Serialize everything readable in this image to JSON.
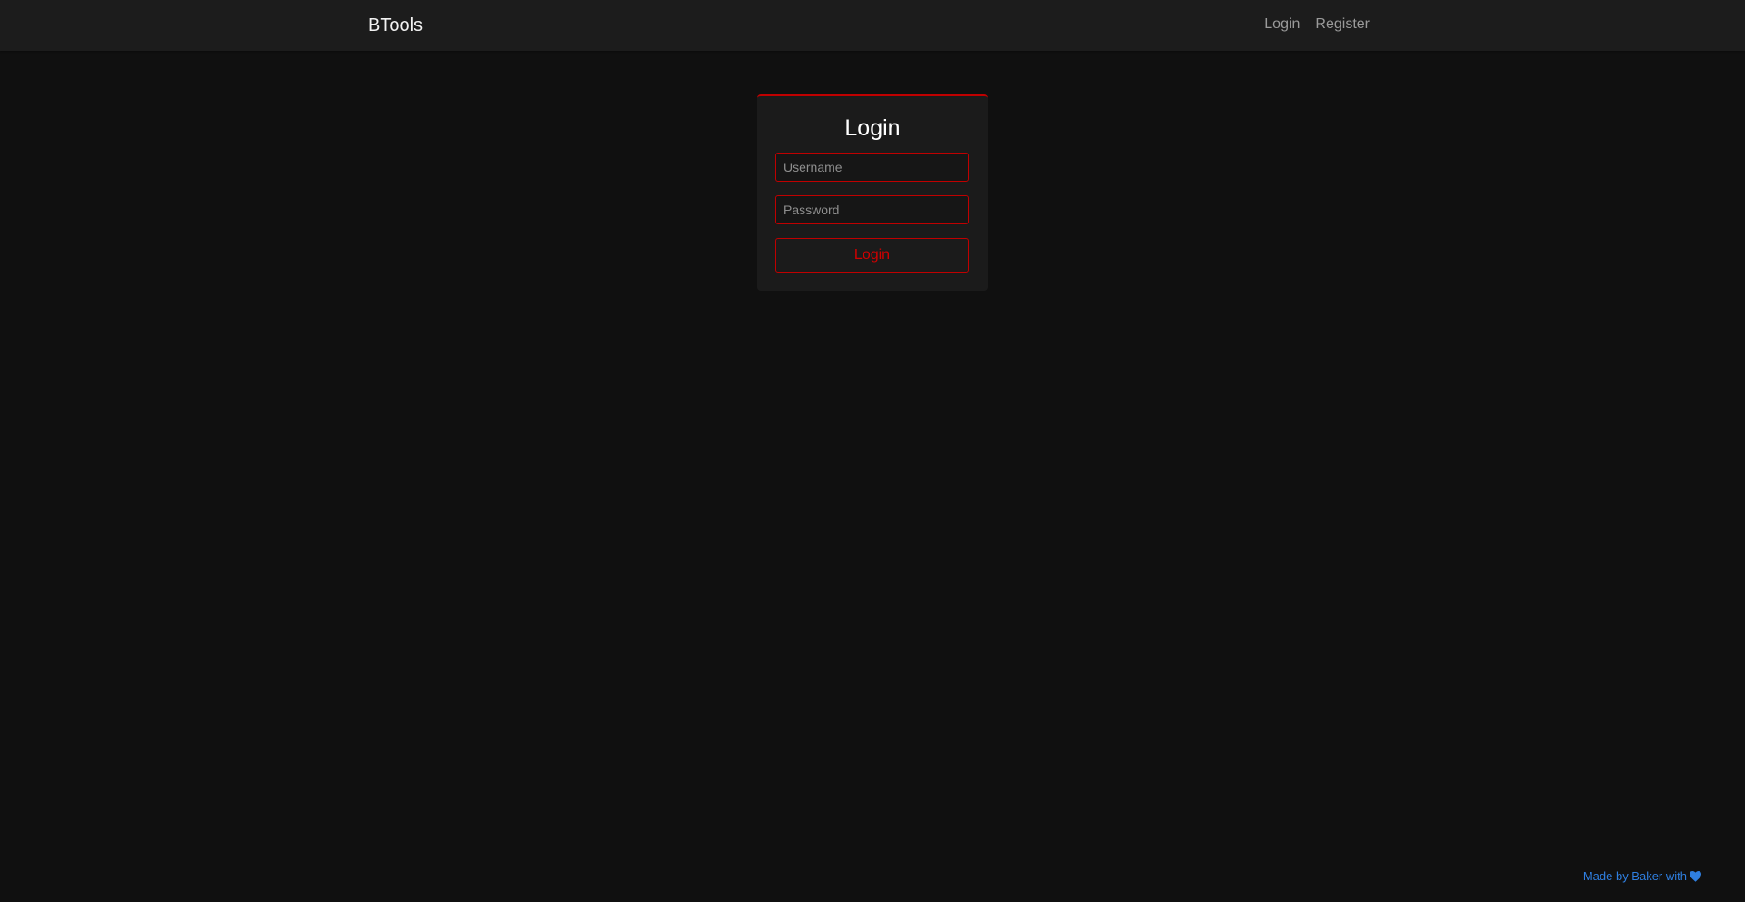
{
  "navbar": {
    "brand": "BTools",
    "links": [
      {
        "label": "Login"
      },
      {
        "label": "Register"
      }
    ]
  },
  "login_card": {
    "title": "Login",
    "username_placeholder": "Username",
    "password_placeholder": "Password",
    "submit_label": "Login"
  },
  "footer": {
    "text": "Made by Baker with",
    "icon": "heart-icon"
  },
  "colors": {
    "background": "#101010",
    "navbar": "#1c1c1c",
    "card": "#1b1b1b",
    "accent": "#c00000",
    "footer_link": "#2f7fe0"
  }
}
